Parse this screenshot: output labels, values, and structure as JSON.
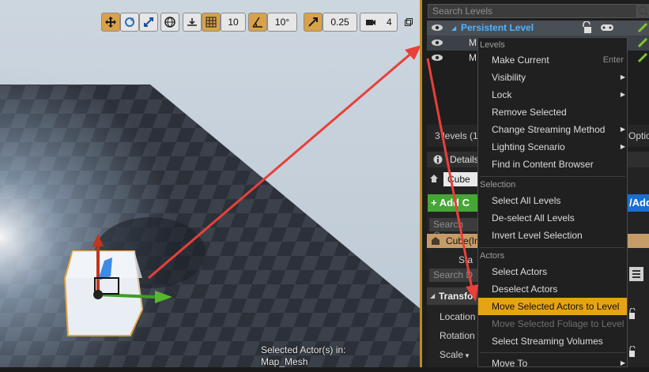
{
  "viewport": {
    "toolbar": {
      "grid_snap_value": "10",
      "rotation_snap_value": "10°",
      "scale_snap_value": "0.25",
      "camera_speed_value": "4"
    },
    "status_line1": "Selected Actor(s) in:",
    "status_line2": "Map_Mesh"
  },
  "levels_panel": {
    "search_placeholder": "Search Levels",
    "persistent_level": "Persistent Level",
    "level_row1": "M",
    "level_row2": "M",
    "levels_count": "3 levels (1",
    "options_label": "Optio"
  },
  "details_panel": {
    "tab_label": "Details",
    "actor_name": "Cube",
    "add_component_label": "+ Add C",
    "blueprint_label": "/Add",
    "search_components_placeholder": "Search Co",
    "component_row": "Cube(In",
    "component_subrow": "Sta",
    "search_details_placeholder": "Search D",
    "transform_header": "Transfo",
    "location_label": "Location",
    "rotation_label": "Rotation",
    "scale_label": "Scale"
  },
  "context_menu": {
    "section_levels": "Levels",
    "items_levels": [
      {
        "label": "Make Current",
        "shortcut": "Enter"
      },
      {
        "label": "Visibility",
        "submenu": true
      },
      {
        "label": "Lock",
        "submenu": true
      },
      {
        "label": "Remove Selected"
      },
      {
        "label": "Change Streaming Method",
        "submenu": true
      },
      {
        "label": "Lighting Scenario",
        "submenu": true
      },
      {
        "label": "Find in Content Browser"
      }
    ],
    "section_selection": "Selection",
    "items_selection": [
      {
        "label": "Select All Levels"
      },
      {
        "label": "De-select All Levels"
      },
      {
        "label": "Invert Level Selection"
      }
    ],
    "section_actors": "Actors",
    "items_actors": [
      {
        "label": "Select Actors"
      },
      {
        "label": "Deselect Actors"
      },
      {
        "label": "Move Selected Actors to Level"
      },
      {
        "label": "Move Selected Foliage to Level"
      },
      {
        "label": "Select Streaming Volumes"
      }
    ],
    "item_move_to": "Move To"
  },
  "colors": {
    "highlight": "#e6a316",
    "persistent_level_text": "#4fb3ff",
    "arrow": "#e8403a",
    "add_button": "#46a636"
  },
  "icons": [
    "move-icon",
    "rotate-icon",
    "scale-icon",
    "world-icon",
    "surface-snap-icon",
    "grid-icon",
    "angle-icon",
    "scale-snap-icon",
    "camera-icon",
    "maximize-icon",
    "eye-icon",
    "lock-icon",
    "gamepad-icon",
    "pencil-icon",
    "search-icon"
  ]
}
